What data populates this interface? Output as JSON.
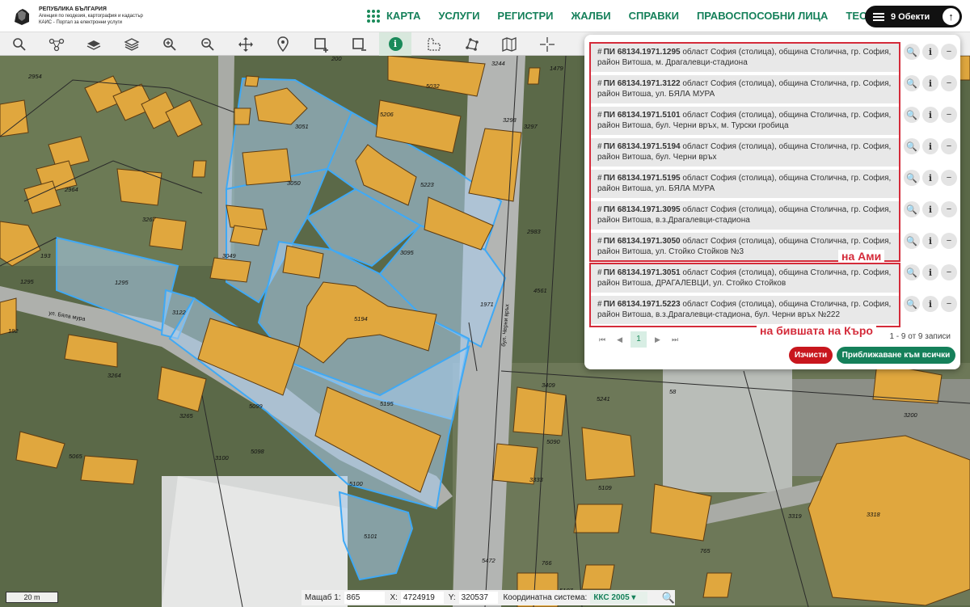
{
  "header": {
    "logo_line1": "РЕПУБЛИКА БЪЛГАРИЯ",
    "logo_line2": "Агенция по геодезия, картография и кадастър",
    "logo_line3": "КАИС - Портал за електронни услуги",
    "nav": [
      "КАРТА",
      "УСЛУГИ",
      "РЕГИСТРИ",
      "ЖАЛБИ",
      "СПРАВКИ",
      "ПРАВОСПОСОБНИ ЛИЦА",
      "ТЕСТ"
    ],
    "objects_label": "9 Обекти"
  },
  "toolbar": {
    "tools": [
      "search-icon",
      "network-icon",
      "layers-stack-icon",
      "layers-icon",
      "zoom-in-icon",
      "zoom-out-icon",
      "pan-icon",
      "location-pin-icon",
      "select-rect-add-icon",
      "select-rect-remove-icon",
      "info-icon",
      "measure-icon",
      "polygon-icon",
      "map-book-icon",
      "crosshair-icon"
    ],
    "active_tool": "info-icon",
    "info_glyph": "i"
  },
  "results": [
    {
      "id": "ПИ 68134.1971.1295",
      "text": " област София (столица), община Столична, гр. София, район Витоша, м. Драгалевци-стадиона"
    },
    {
      "id": "ПИ 68134.1971.3122",
      "text": " област София (столица), община Столична, гр. София, район Витоша, ул. БЯЛА МУРА"
    },
    {
      "id": "ПИ 68134.1971.5101",
      "text": " област София (столица), община Столична, гр. София, район Витоша, бул. Черни връх, м. Турски гробица"
    },
    {
      "id": "ПИ 68134.1971.5194",
      "text": " област София (столица), община Столична, гр. София, район Витоша, бул. Черни връх"
    },
    {
      "id": "ПИ 68134.1971.5195",
      "text": " област София (столица), община Столична, гр. София, район Витоша, ул. БЯЛА МУРА"
    },
    {
      "id": "ПИ 68134.1971.3095",
      "text": " област София (столица), община Столична, гр. София, район Витоша, в.з.Драгалевци-стадиона"
    },
    {
      "id": "ПИ 68134.1971.3050",
      "text": " област София (столица), община Столична, гр. София, район Витоша, ул. Стойко Стойков №3"
    },
    {
      "id": "ПИ 68134.1971.3051",
      "text": " област София (столица), община Столична, гр. София, район Витоша, ДРАГАЛЕВЦИ, ул. Стойко Стойков"
    },
    {
      "id": "ПИ 68134.1971.5223",
      "text": " област София (столица), община Столична, гр. София, район Витоша, в.з.Драгалевци-стадиона, бул. Черни връх №222"
    }
  ],
  "annotations": {
    "ami": "на Ами",
    "kuro": "на бившата на Къро"
  },
  "pager": {
    "first": "⏮",
    "prev": "◀",
    "page": "1",
    "next": "▶",
    "last": "⏭",
    "count": "1 - 9 от 9 записи"
  },
  "buttons": {
    "clear": "Изчисти",
    "zoom_all": "Приближаване към всички"
  },
  "map_labels": {
    "parcels": [
      "2954",
      "2964",
      "200",
      "5032",
      "3244",
      "1479",
      "3298",
      "3297",
      "5206",
      "3051",
      "3050",
      "5223",
      "2983",
      "3267",
      "3049",
      "3095",
      "193",
      "1295",
      "1295",
      "3122",
      "1971",
      "4561",
      "192",
      "5194",
      "5195",
      "5099",
      "5098",
      "5065",
      "3264",
      "3265",
      "3100",
      "5100",
      "5101",
      "5472",
      "766",
      "3409",
      "58",
      "5241",
      "5090",
      "5109",
      "3333",
      "3200",
      "3319",
      "3318",
      "765",
      "5107"
    ],
    "street_1": "ул. Бяла мура",
    "street_2": "бул. Черни връх"
  },
  "status": {
    "scale_bar": "20 m",
    "scale_label": "Мащаб 1:",
    "scale_value": "865",
    "x_label": "X:",
    "x_value": "4724919",
    "y_label": "Y:",
    "y_value": "320537",
    "crs_label": "Координатна система:",
    "crs_value": "ККС 2005"
  },
  "colors": {
    "brand_green": "#15805a",
    "annotation_red": "#d42b3a",
    "building": "#e0a73e",
    "parcel_outline": "#3fa9f5"
  }
}
